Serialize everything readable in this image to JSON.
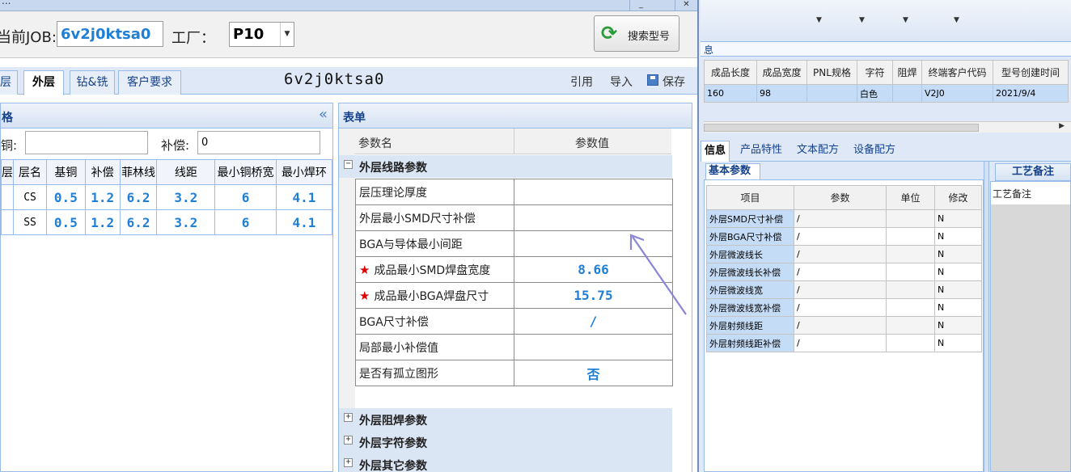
{
  "left_window": {
    "title": "...",
    "controls": {
      "minimize": "_",
      "close": "✕"
    },
    "job_label": "当前JOB:",
    "job_value": "6v2j0ktsa0",
    "factory_label": "工厂：",
    "factory_value": "P10",
    "search_button": "搜索型号",
    "tabs": [
      "层",
      "外层",
      "钻&铣",
      "客户要求"
    ],
    "active_tab": "外层",
    "job_title": "6v2j0ktsa0",
    "toolbar": {
      "cite": "引用",
      "import": "导入",
      "save": "保存"
    },
    "spec_panel": {
      "title": "格",
      "collapse": "«",
      "copy_label": "铜:",
      "copy_value": "",
      "comp_label": "补偿:",
      "comp_value": "0",
      "headers": [
        "层",
        "层名",
        "基铜",
        "补偿",
        "菲林线",
        "线距",
        "最小铜桥宽",
        "最小焊环"
      ],
      "rows": [
        [
          "",
          "CS",
          "0.5",
          "1.2",
          "6.2",
          "3.2",
          "6",
          "4.1"
        ],
        [
          "",
          "SS",
          "0.5",
          "1.2",
          "6.2",
          "3.2",
          "6",
          "4.1"
        ]
      ]
    },
    "form_panel": {
      "title": "表单",
      "col_name": "参数名",
      "col_value": "参数值",
      "expanded_group": "外层线路参数",
      "params": [
        {
          "name": "层压理论厚度",
          "value": "",
          "required": false
        },
        {
          "name": "外层最小SMD尺寸补偿",
          "value": "",
          "required": false
        },
        {
          "name": "BGA与导体最小间距",
          "value": "",
          "required": false
        },
        {
          "name": "成品最小SMD焊盘宽度",
          "value": "8.66",
          "required": true
        },
        {
          "name": "成品最小BGA焊盘尺寸",
          "value": "15.75",
          "required": true
        },
        {
          "name": "BGA尺寸补偿",
          "value": "/",
          "required": false
        },
        {
          "name": "局部最小补偿值",
          "value": "",
          "required": false
        },
        {
          "name": "是否有孤立图形",
          "value": "否",
          "required": false
        }
      ],
      "collapsed_groups": [
        "外层阻焊参数",
        "外层字符参数",
        "外层其它参数"
      ]
    }
  },
  "right_window": {
    "info_label": "息",
    "grid_headers": [
      "成品长度",
      "成品宽度",
      "PNL规格",
      "字符",
      "阻焊",
      "终端客户代码",
      "型号创建时间"
    ],
    "grid_row": [
      "160",
      "98",
      "",
      "白色",
      "",
      "V2J0",
      "2021/9/4"
    ],
    "tabs": [
      "信息",
      "产品特性",
      "文本配方",
      "设备配方"
    ],
    "active_tab": "信息",
    "basic_tab": "基本参数",
    "basic_headers": [
      "项目",
      "参数",
      "单位",
      "修改"
    ],
    "basic_rows": [
      [
        "外层SMD尺寸补偿",
        "/",
        "",
        "N"
      ],
      [
        "外层BGA尺寸补偿",
        "/",
        "",
        "N"
      ],
      [
        "外层微波线长",
        "/",
        "",
        "N"
      ],
      [
        "外层微波线长补偿",
        "/",
        "",
        "N"
      ],
      [
        "外层微波线宽",
        "/",
        "",
        "N"
      ],
      [
        "外层微波线宽补偿",
        "/",
        "",
        "N"
      ],
      [
        "外层射频线距",
        "/",
        "",
        "N"
      ],
      [
        "外层射频线距补偿",
        "/",
        "",
        "N"
      ]
    ],
    "notes_tab": "工艺备注",
    "notes_header": "工艺备注"
  },
  "colors": {
    "accent_blue": "#1f7fd6",
    "panel_border": "#99bbe8",
    "selected_row": "#c5dcf6",
    "required_star": "#e00000"
  },
  "icons": [
    "refresh-icon",
    "save-icon",
    "dropdown-arrow-icon",
    "star-icon",
    "expand-icon",
    "collapse-icon",
    "pointer-arrow"
  ]
}
